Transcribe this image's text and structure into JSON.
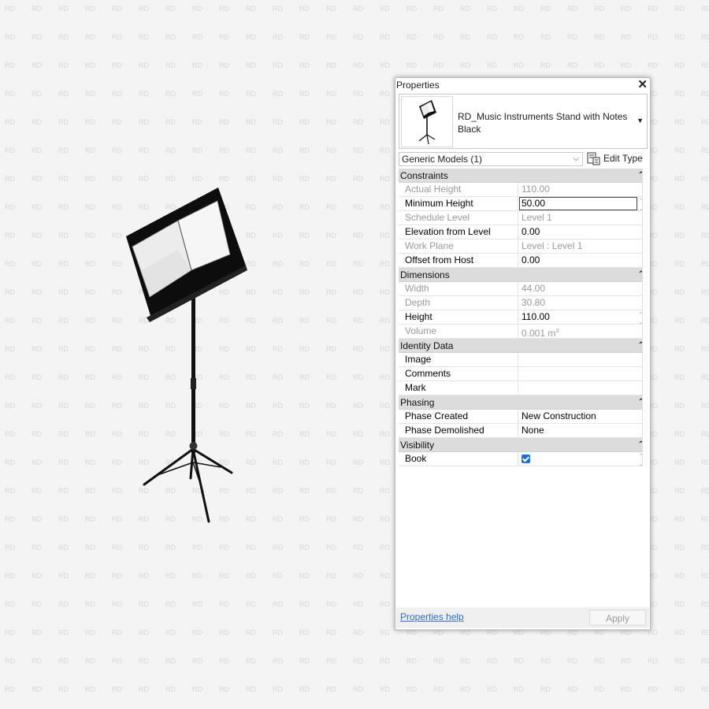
{
  "watermark": "RD",
  "properties": {
    "title": "Properties",
    "close_glyph": "✕",
    "type_selector": {
      "name": "RD_Music Instruments Stand with Notes Black",
      "caret": "▼"
    },
    "filter": {
      "value": "Generic Models (1)",
      "caret": "⌵"
    },
    "edit_type_label": "Edit Type",
    "sections": [
      {
        "title": "Constraints",
        "rows": [
          {
            "name": "Actual Height",
            "value": "110.00",
            "readonly": true
          },
          {
            "name": "Minimum Height",
            "value": "50.00",
            "readonly": false,
            "active": true
          },
          {
            "name": "Schedule Level",
            "value": "Level 1",
            "readonly": true
          },
          {
            "name": "Elevation from Level",
            "value": "0.00",
            "readonly": false
          },
          {
            "name": "Work Plane",
            "value": "Level : Level 1",
            "readonly": true
          },
          {
            "name": "Offset from Host",
            "value": "0.00",
            "readonly": false
          }
        ]
      },
      {
        "title": "Dimensions",
        "rows": [
          {
            "name": "Width",
            "value": "44.00",
            "readonly": true
          },
          {
            "name": "Depth",
            "value": "30.80",
            "readonly": true
          },
          {
            "name": "Height",
            "value": "110.00",
            "readonly": false
          },
          {
            "name": "Volume",
            "value": "0.001 m",
            "unit_sup": "3",
            "readonly": true
          }
        ]
      },
      {
        "title": "Identity Data",
        "rows": [
          {
            "name": "Image",
            "value": "",
            "readonly": false
          },
          {
            "name": "Comments",
            "value": "",
            "readonly": false
          },
          {
            "name": "Mark",
            "value": "",
            "readonly": false
          }
        ]
      },
      {
        "title": "Phasing",
        "rows": [
          {
            "name": "Phase Created",
            "value": "New Construction",
            "readonly": false
          },
          {
            "name": "Phase Demolished",
            "value": "None",
            "readonly": false
          }
        ]
      },
      {
        "title": "Visibility",
        "rows": [
          {
            "name": "Book",
            "value": "",
            "checkbox": true,
            "checked": true,
            "readonly": false
          }
        ]
      }
    ],
    "help_link": "Properties help",
    "apply_label": "Apply"
  },
  "colors": {
    "background": "#f4f4f4",
    "link": "#2a6ac2",
    "checkbox": "#1a6fcf",
    "section_header": "#dcdcdc"
  }
}
